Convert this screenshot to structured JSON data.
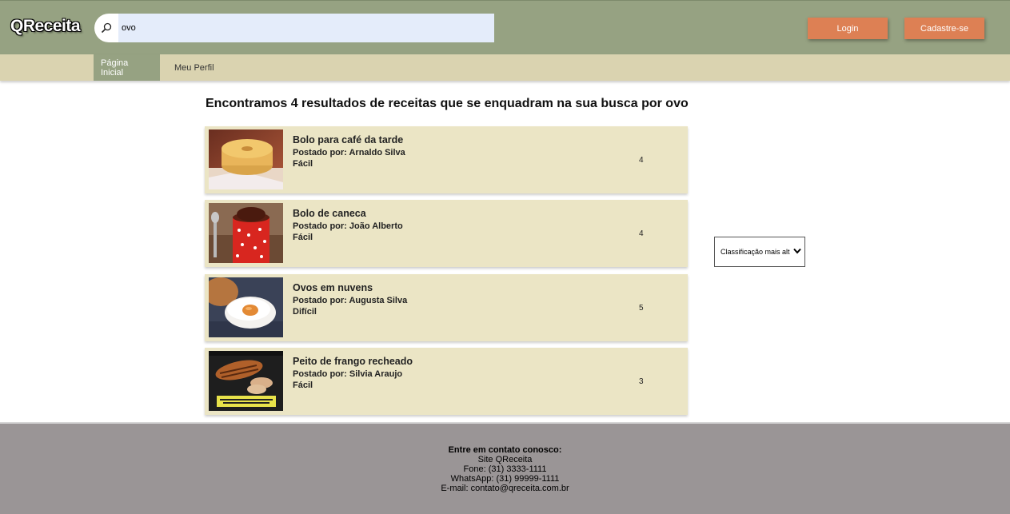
{
  "header": {
    "logo": "QReceita",
    "search": {
      "value": "ovo"
    },
    "login_label": "Login",
    "signup_label": "Cadastre-se"
  },
  "nav": {
    "items": [
      {
        "label": "Página Inicial",
        "active": true
      },
      {
        "label": "Meu Perfil",
        "active": false
      }
    ]
  },
  "main": {
    "heading": "Encontramos 4 resultados de receitas que se enquadram na sua busca por ovo",
    "results": [
      {
        "title": "Bolo para café da tarde",
        "author": "Postado por: Arnaldo Silva",
        "difficulty": "Fácil",
        "rating": "4",
        "thumb_icon": "cake-photo"
      },
      {
        "title": "Bolo de caneca",
        "author": "Postado por: João Alberto",
        "difficulty": "Fácil",
        "rating": "4",
        "thumb_icon": "mug-cake-photo"
      },
      {
        "title": "Ovos em nuvens",
        "author": "Postado por: Augusta Silva",
        "difficulty": "Difícil",
        "rating": "5",
        "thumb_icon": "cloud-eggs-photo"
      },
      {
        "title": "Peito de frango recheado",
        "author": "Postado por: Silvia Araujo",
        "difficulty": "Fácil",
        "rating": "3",
        "thumb_icon": "stuffed-chicken-photo"
      }
    ],
    "sort": {
      "selected": "Classificação mais alt"
    }
  },
  "footer": {
    "heading": "Entre em contato conosco:",
    "site": "Site QReceita",
    "phone": "Fone: (31) 3333-1111",
    "whatsapp": "WhatsApp: (31) 99999-1111",
    "email": "E-mail: contato@qreceita.com.br"
  },
  "colors": {
    "header_bg": "#96a282",
    "nav_bg": "#dad3b0",
    "card_bg": "#ebe5c5",
    "button_bg": "#dd8054",
    "footer_bg": "#9a9596"
  }
}
